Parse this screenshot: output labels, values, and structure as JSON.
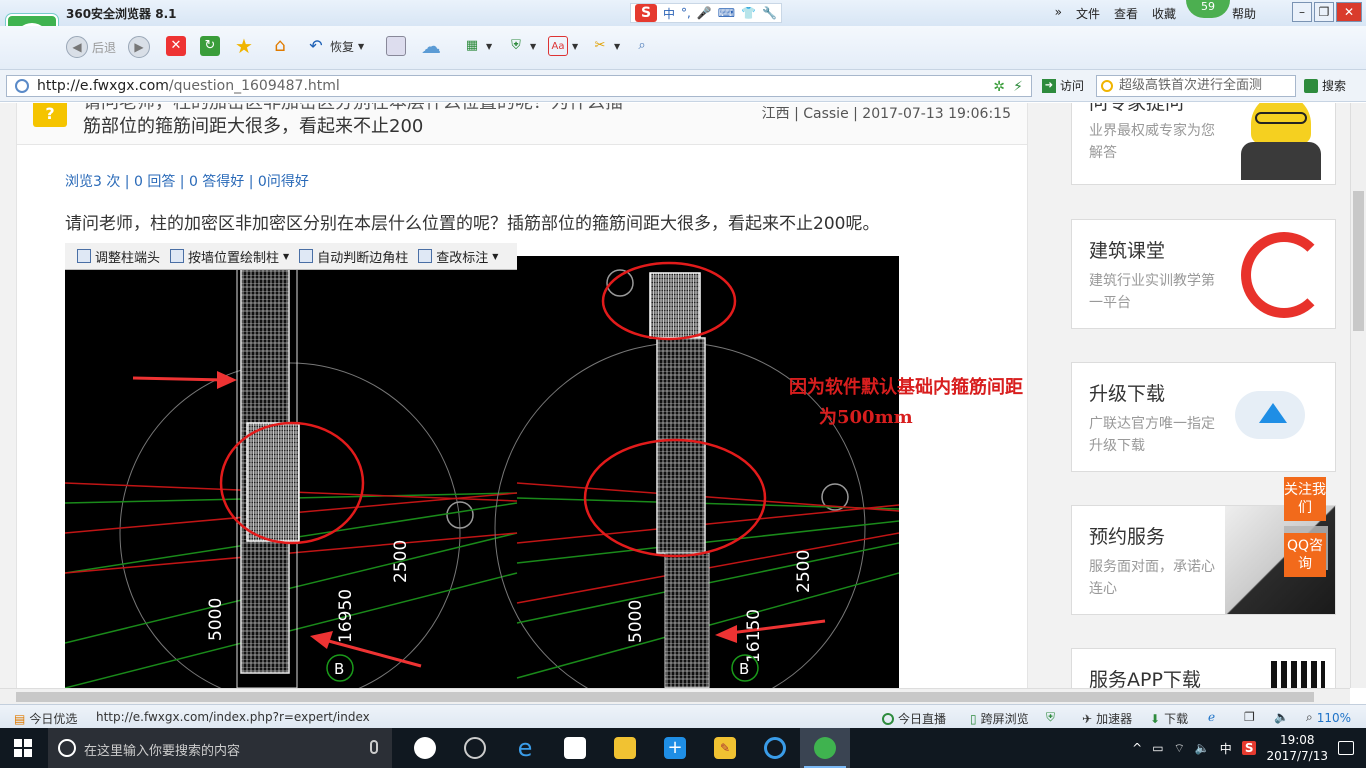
{
  "browser": {
    "title": "360安全浏览器 8.1",
    "menu": [
      "文件",
      "查看",
      "收藏",
      "帮助"
    ],
    "user_badge": "59",
    "toolbar": {
      "back_label": "后退",
      "restore_label": "恢复"
    },
    "address": {
      "host": "http://e.fwxgx.com",
      "path": "/question_1609487.html"
    },
    "visit_label": "访问",
    "search_placeholder": "超级高铁首次进行全面测",
    "search_label": "搜索"
  },
  "ime": {
    "mode_label": "中",
    "punct_label": "°,"
  },
  "question": {
    "title_line1": "请问老师，柱的加密区非加密区分别在本层什么位置的呢？为什么插",
    "title_line2": "筋部位的箍筋间距大很多，看起来不止200",
    "meta": "江西 | Cassie | 2017-07-13 19:06:15",
    "stats": "浏览3 次 | 0 回答 | 0 答得好 | 0问得好",
    "body": "请问老师，柱的加密区非加密区分别在本层什么位置的呢？插筋部位的箍筋间距大很多，看起来不止200呢。"
  },
  "figure": {
    "toolbar": [
      "调整柱端头",
      "按墙位置绘制柱",
      "自动判断边角柱",
      "查改标注"
    ],
    "dims_left": [
      "5000",
      "16950",
      "2500"
    ],
    "dims_right": [
      "5000",
      "16150",
      "2500"
    ],
    "axis_label": "B",
    "note_line1": "因为软件默认基础内箍筋间距",
    "note_line2": "为500mm"
  },
  "sidebar": [
    {
      "title": "问专家提问",
      "desc": "业界最权威专家为您解答"
    },
    {
      "title": "建筑课堂",
      "desc": "建筑行业实训教学第一平台"
    },
    {
      "title": "升级下载",
      "desc": "广联达官方唯一指定升级下载"
    },
    {
      "title": "预约服务",
      "desc": "服务面对面，承诺心连心"
    },
    {
      "title": "服务APP下载",
      "desc": ""
    }
  ],
  "float_buttons": {
    "follow": "关注我们",
    "qq": "QQ咨询"
  },
  "status": {
    "today": "今日优选",
    "url": "http://e.fwxgx.com/index.php?r=expert/index",
    "live": "今日直播",
    "cross": "跨屏浏览",
    "accel": "加速器",
    "download": "下载",
    "zoom": "110%"
  },
  "taskbar": {
    "search_placeholder": "在这里输入你要搜索的内容",
    "ime": "中",
    "time": "19:08",
    "date": "2017/7/13"
  }
}
